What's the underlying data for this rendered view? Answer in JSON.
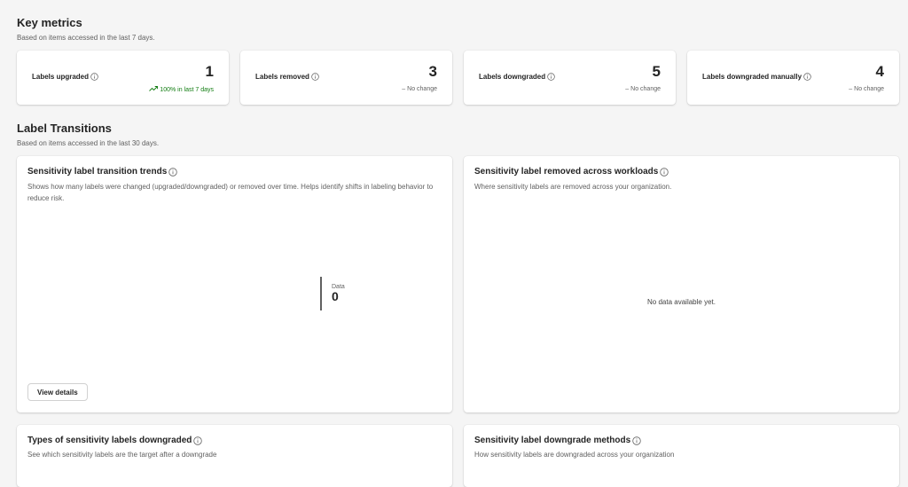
{
  "key_metrics": {
    "title": "Key metrics",
    "subtitle": "Based on items accessed in the last 7 days.",
    "cards": [
      {
        "label": "Labels upgraded",
        "value": "1",
        "trend_icon": "arrow-trending-up-icon",
        "trend_text": "100% in last 7 days",
        "trend_status": "up"
      },
      {
        "label": "Labels removed",
        "value": "3",
        "trend_icon": "dash-icon",
        "trend_text": "No change",
        "trend_status": "none"
      },
      {
        "label": "Labels downgraded",
        "value": "5",
        "trend_icon": "dash-icon",
        "trend_text": "No change",
        "trend_status": "none"
      },
      {
        "label": "Labels downgraded manually",
        "value": "4",
        "trend_icon": "dash-icon",
        "trend_text": "No change",
        "trend_status": "none"
      }
    ]
  },
  "label_transitions": {
    "title": "Label Transitions",
    "subtitle": "Based on items accessed in the last 30 days."
  },
  "panels": {
    "trends": {
      "title": "Sensitivity label transition trends",
      "description": "Shows how many labels were changed (upgraded/downgraded) or removed over time. Helps identify shifts in labeling behavior to reduce risk.",
      "readout_label": "Data",
      "readout_value": "0",
      "button_label": "View details"
    },
    "removed": {
      "title": "Sensitivity label removed across workloads",
      "description": "Where sensitivity labels are removed across your organization.",
      "empty_message": "No data available yet."
    },
    "types": {
      "title": "Types of sensitivity labels downgraded",
      "description": "See which sensitivity labels are the target after a downgrade"
    },
    "methods": {
      "title": "Sensitivity label downgrade methods",
      "description": "How sensitivity labels are downgraded across your organization"
    }
  },
  "colors": {
    "background": "#f5f5f5",
    "card": "#ffffff",
    "trend_up": "#107c10",
    "muted_text": "#616161"
  }
}
